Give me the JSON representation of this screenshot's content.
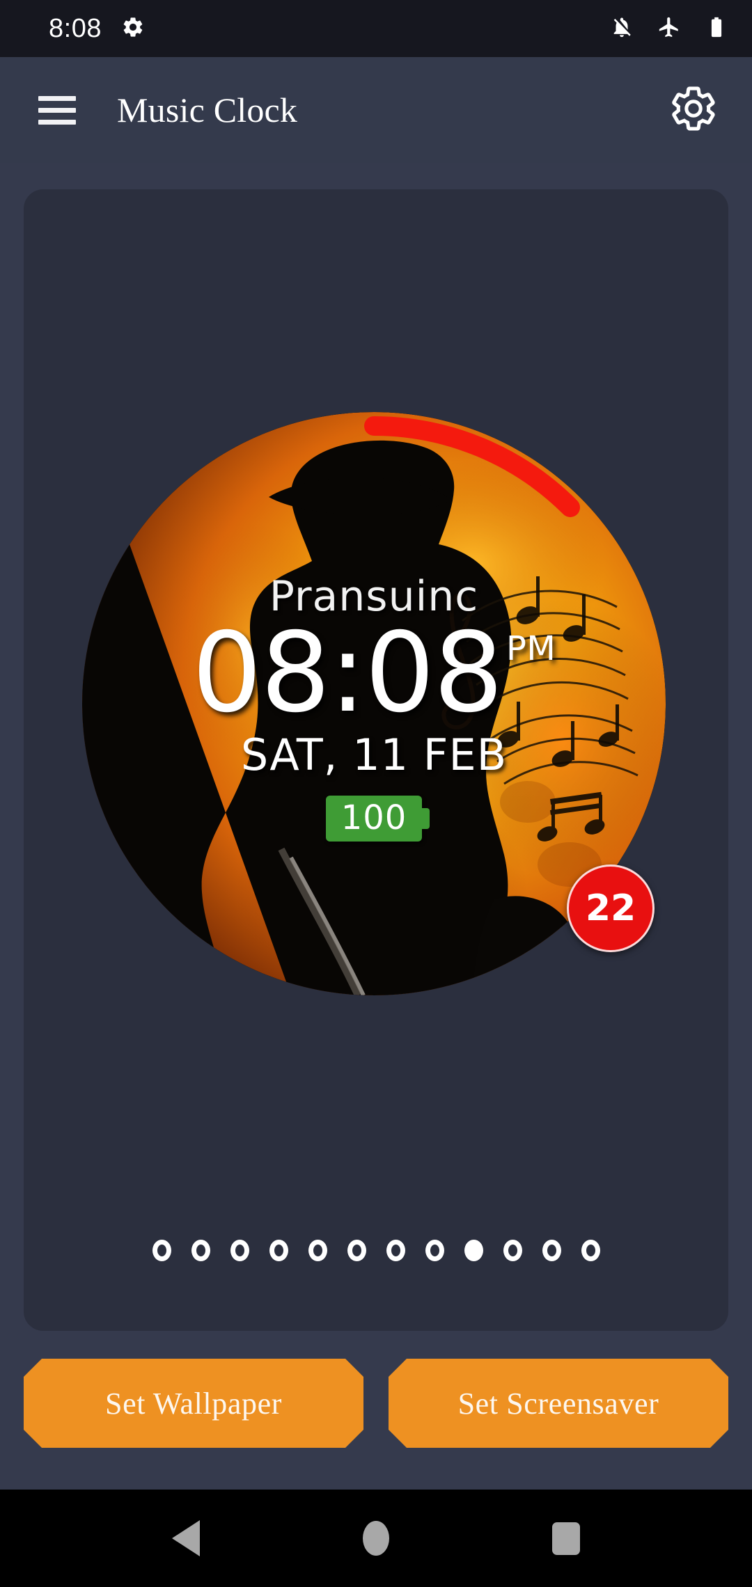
{
  "status_bar": {
    "time": "8:08",
    "icons": [
      "gear-icon",
      "notifications-off-icon",
      "airplane-mode-icon",
      "battery-full-icon"
    ]
  },
  "app_bar": {
    "menu_icon": "hamburger-menu-icon",
    "title": "Music Clock",
    "settings_icon": "gear-icon"
  },
  "clock_widget": {
    "label": "Pransuinc",
    "time": "08:08",
    "meridiem": "PM",
    "date": "SAT, 11 FEB",
    "battery_level": "100",
    "temperature": "22",
    "arc_color": "#f41a0e",
    "battery_badge_color": "#3f9c35",
    "temperature_badge_color": "#e81010"
  },
  "page_indicator": {
    "total": 12,
    "active_index": 8
  },
  "actions": {
    "set_wallpaper_label": "Set Wallpaper",
    "set_screensaver_label": "Set Screensaver",
    "button_color": "#ee9122"
  },
  "nav_bar": {
    "back": "back-triangle-icon",
    "home": "home-circle-icon",
    "recents": "recents-square-icon"
  },
  "theme": {
    "page_background": "#353a4d",
    "card_background": "#2b2f3e",
    "status_bar_background": "#16171f",
    "nav_bar_background": "#000000"
  }
}
